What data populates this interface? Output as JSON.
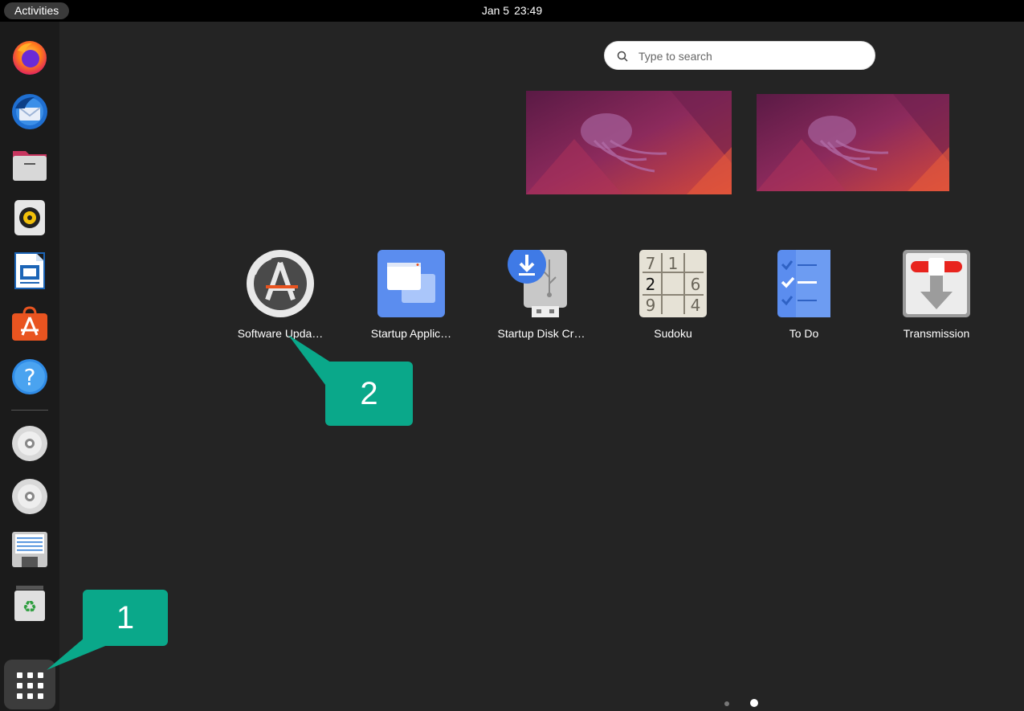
{
  "topbar": {
    "activities": "Activities",
    "date": "Jan 5",
    "time": "23:49"
  },
  "dock": {
    "items": [
      "firefox-icon",
      "thunderbird-icon",
      "files-icon",
      "rhythmbox-icon",
      "libreoffice-writer-icon",
      "app-center-icon",
      "help-icon",
      "disc-icon",
      "disc-icon",
      "floppy-icon",
      "trash-icon"
    ],
    "show_apps": "show-applications-grid-icon"
  },
  "search": {
    "placeholder": "Type to search"
  },
  "apps": [
    {
      "label": "Software Upda…",
      "icon": "software-updater-icon"
    },
    {
      "label": "Startup Applic…",
      "icon": "startup-applications-icon"
    },
    {
      "label": "Startup Disk Cr…",
      "icon": "startup-disk-creator-icon"
    },
    {
      "label": "Sudoku",
      "icon": "sudoku-icon"
    },
    {
      "label": "To Do",
      "icon": "todo-icon"
    },
    {
      "label": "Transmission",
      "icon": "transmission-icon"
    }
  ],
  "sudoku_digits": [
    "7",
    "1",
    "2",
    "6",
    "9",
    "4"
  ],
  "callouts": {
    "first": "1",
    "second": "2"
  },
  "pager": {
    "pages": 2,
    "current": 2
  },
  "colors": {
    "callout": "#0aa88a",
    "background": "#242424",
    "dock": "#1b1b1b",
    "topbar": "#000000"
  }
}
